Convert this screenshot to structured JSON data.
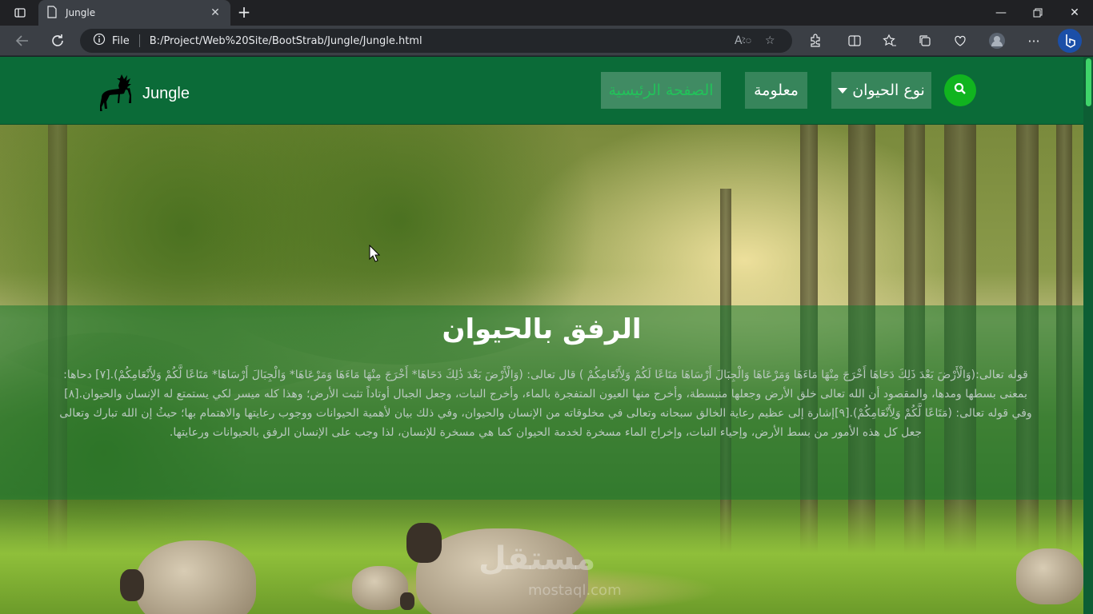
{
  "browser": {
    "tab_title": "Jungle",
    "file_label": "File",
    "url": "B:/Project/Web%20Site/BootStrab/Jungle/Jungle.html",
    "read_aloud_icon": "read-aloud-icon",
    "colors": {
      "chrome": "#202124",
      "toolbar": "#3b3f45",
      "address": "#23262a"
    }
  },
  "site": {
    "brand": "Jungle",
    "nav": {
      "home": "الصفحة الرئيسية",
      "info": "معلومة",
      "animal_type": "نوع الحيوان"
    },
    "colors": {
      "navbar": "#0b6b38",
      "search": "#11b41f",
      "home_text": "#22c25a"
    }
  },
  "hero": {
    "title": "الرفق بالحيوان",
    "text": "قوله تعالى:(وَالْأَرْضَ بَعْدَ ذَلِكَ دَحَاهَا أَخْرَجَ مِنْهَا مَاءَهَا وَمَرْعَاهَا وَالْجِبَالَ أَرْسَاهَا مَتَاعًا لَكُمْ وَلِأَنْعَامِكُمْ ) قال تعالى: (وَالْأَرْضَ بَعْدَ ذَٰلِكَ دَحَاهَا* أَخْرَجَ مِنْهَا مَاءَهَا وَمَرْعَاهَا* وَالْجِبَالَ أَرْسَاهَا* مَتَاعًا لَّكُمْ وَلِأَنْعَامِكُمْ).[٧] دحاها: بمعنى بسطها ومدها، والمقصود أن الله تعالى خلق الأرض وجعلها منبسطة، وأخرج منها العيون المتفجرة بالماء، وأخرج النبات، وجعل الجبال أوتاداً تثبت الأرض؛ وهذا كله ميسر لكي يستمتع له الإنسان والحيوان.[٨] وفي قوله تعالى: (مَتَاعًا لَّكُمْ وَلِأَنْعَامِكُمْ).[٩]إشارة إلى عظيم رعاية الخالق سبحانه وتعالى في مخلوقاته من الإنسان والحيوان، وفي ذلك بيان لأهمية الحيوانات ووجوب رعايتها والاهتمام بها؛ حيثُ إن الله تبارك وتعالى جعل كل هذه الأمور من بسط الأرض، وإحياء النبات، وإخراج الماء مسخرة لخدمة الحيوان كما هي مسخرة للإنسان، لذا وجب على الإنسان الرفق بالحيوانات ورعايتها.",
    "watermark": "مستقل",
    "watermark_sub": "mostaql.com"
  }
}
